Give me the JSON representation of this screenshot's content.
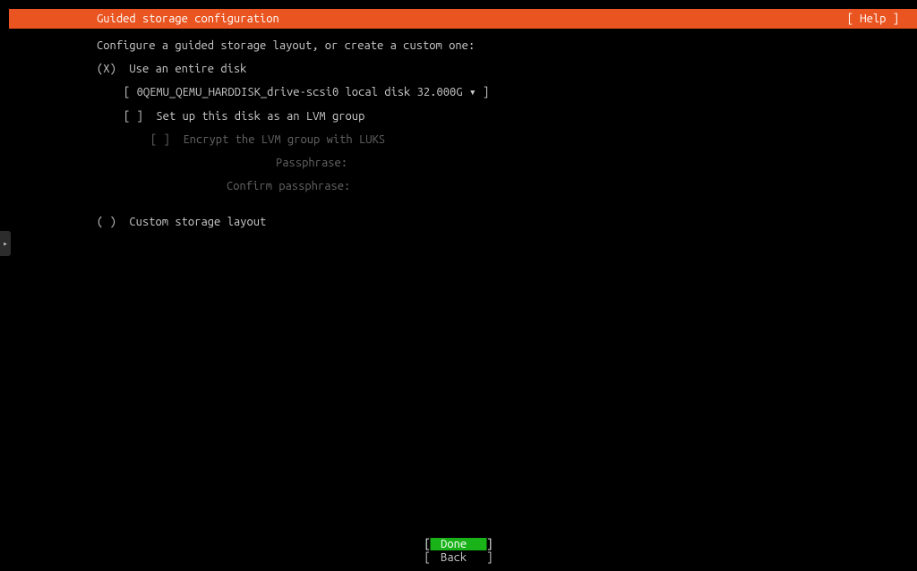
{
  "header": {
    "title": "Guided storage configuration",
    "help": "[ Help ]"
  },
  "content": {
    "intro": "Configure a guided storage layout, or create a custom one:",
    "option_entire_disk": {
      "marker": "(X)",
      "label": "Use an entire disk"
    },
    "disk_selector": {
      "open": "[ ",
      "value": "0QEMU_QEMU_HARDDISK_drive-scsi0 local disk 32.000G",
      "dropdown": " ▾ ",
      "close": "]"
    },
    "lvm_checkbox": {
      "marker": "[ ]",
      "label": "Set up this disk as an LVM group"
    },
    "encrypt_checkbox": {
      "marker": "[ ]",
      "label": "Encrypt the LVM group with LUKS"
    },
    "passphrase_label": "Passphrase:",
    "confirm_passphrase_label": "Confirm passphrase:",
    "option_custom": {
      "marker": "( )",
      "label": "Custom storage layout"
    }
  },
  "footer": {
    "done": "Done",
    "back": "Back"
  },
  "side_tab_icon": "▸"
}
